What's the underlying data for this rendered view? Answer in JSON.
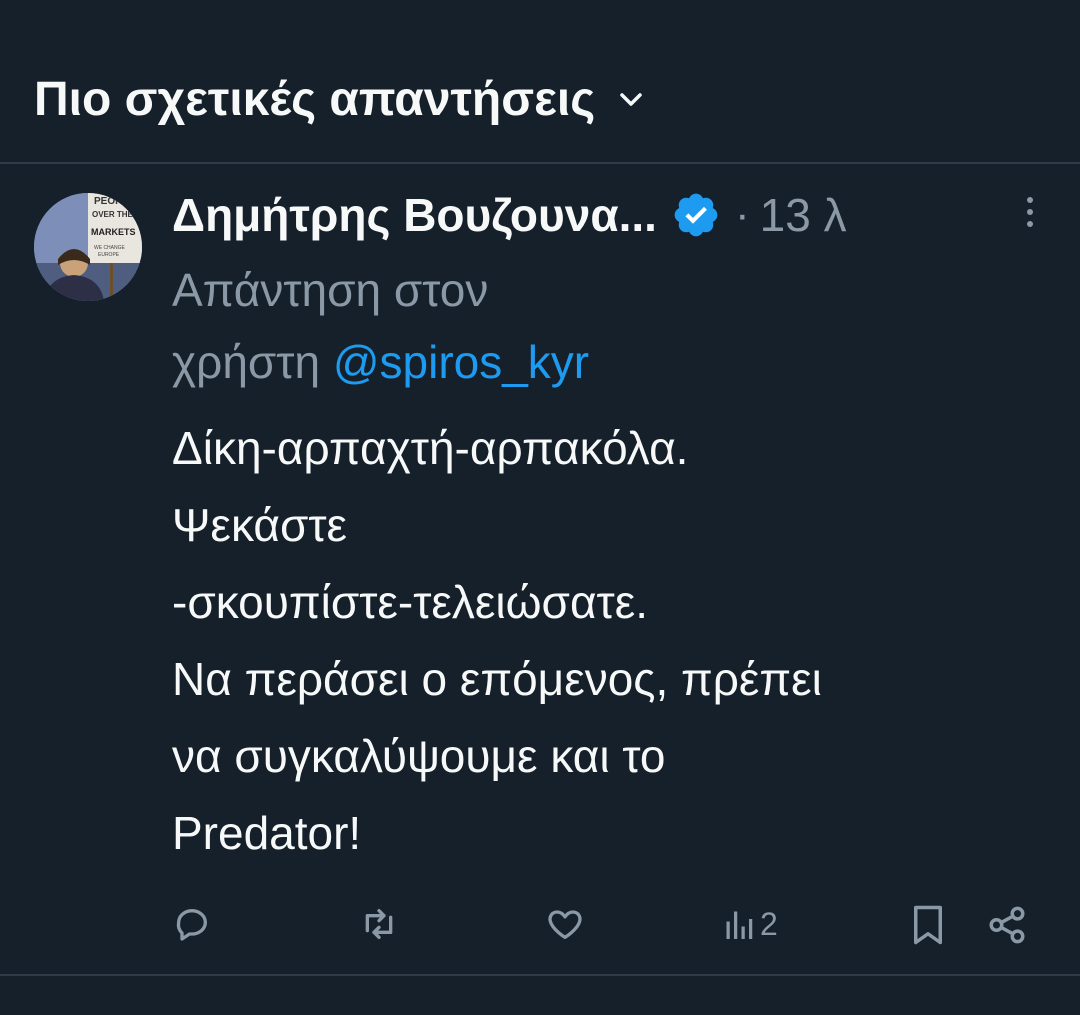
{
  "sort": {
    "label": "Πιο σχετικές απαντήσεις",
    "icon": "chevron-down-icon"
  },
  "tweet": {
    "author": {
      "name": "Δημήτρης Βουζουνα...",
      "verified": true,
      "avatar_sign_lines": [
        "PEOP",
        "OVER THE",
        "MARKETS",
        "WE CHANGE",
        "EUROPE"
      ]
    },
    "separator": "·",
    "time": "13 λ",
    "reply_prefix_line1": "Απάντηση στον",
    "reply_prefix_line2": "χρήστη",
    "reply_handle": "@spiros_kyr",
    "text": "Δίκη-αρπαχτή-αρπακόλα.\nΨεκάστε\n-σκουπίστε-τελειώσατε.\nΝα περάσει ο επόμενος, πρέπει\nνα συγκαλύψουμε και το\nPredator!",
    "actions": {
      "views_count": "2"
    }
  },
  "colors": {
    "background": "#15202b",
    "text": "#f7f9f9",
    "secondary": "#8b98a5",
    "accent": "#1d9bf0",
    "divider": "#2f3b47"
  }
}
